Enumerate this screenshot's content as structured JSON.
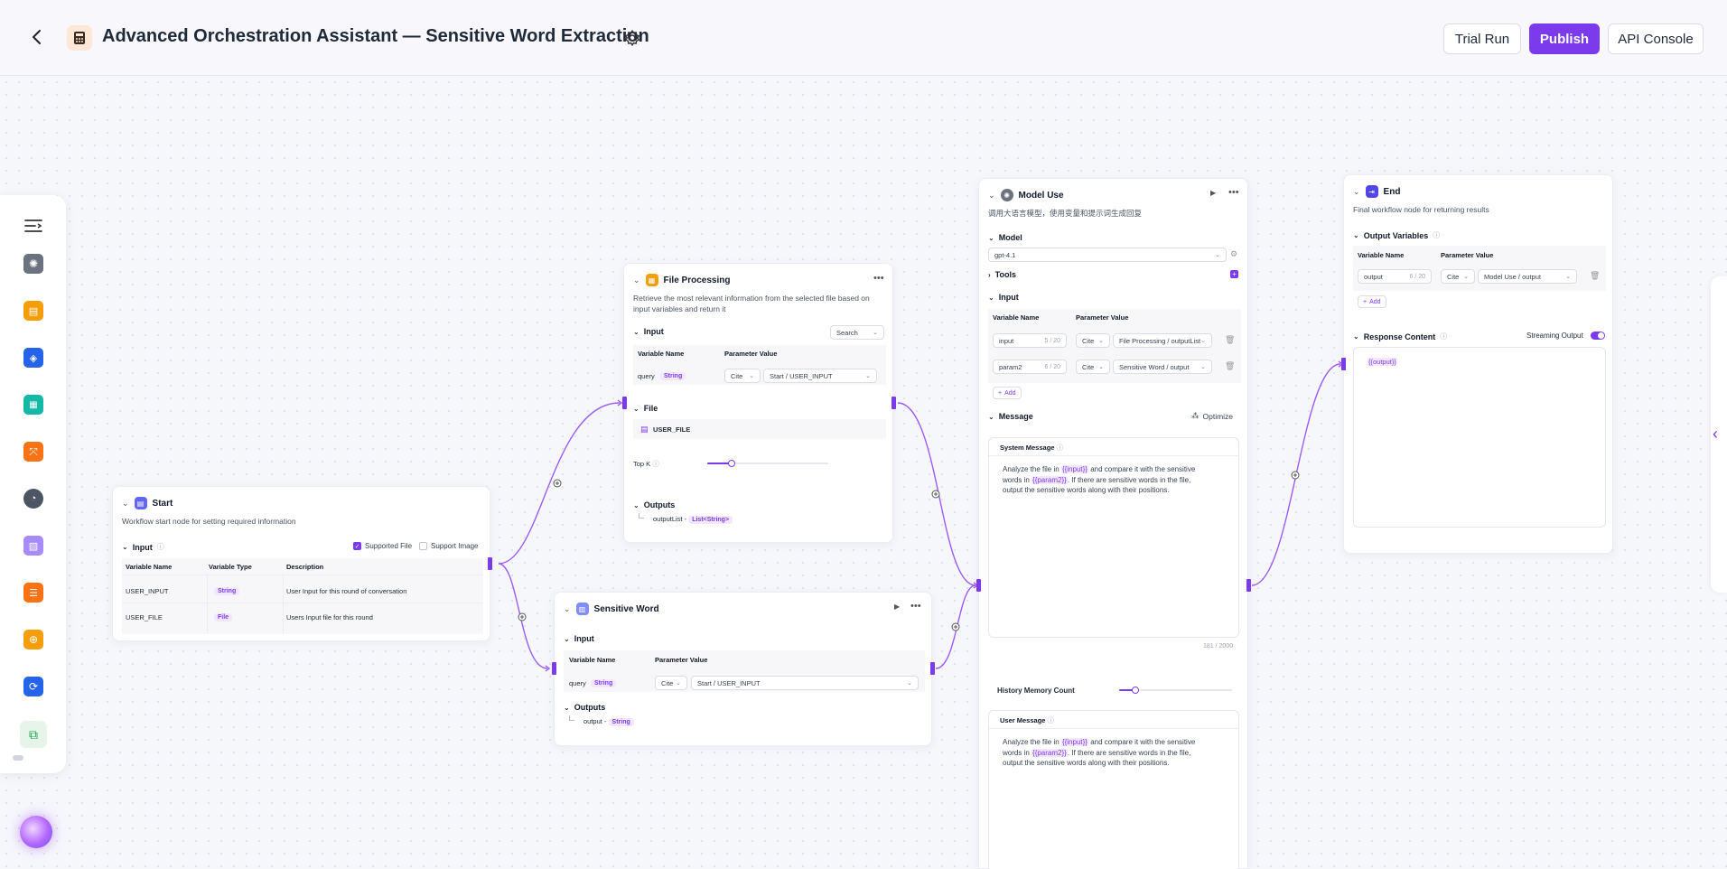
{
  "header": {
    "title": "Advanced Orchestration Assistant — Sensitive Word Extraction",
    "trial_run": "Trial Run",
    "publish": "Publish",
    "api_console": "API Console"
  },
  "sidebar": {
    "items": [
      "openai-icon",
      "note-icon",
      "cube-icon",
      "calendar-icon",
      "expand-icon",
      "chart-icon",
      "document-icon",
      "database-icon",
      "add-image-icon",
      "loop-icon",
      "workflow-icon"
    ]
  },
  "nodes": {
    "start": {
      "title": "Start",
      "desc": "Workflow start node for setting required information",
      "input_label": "Input",
      "supported_file": "Supported File",
      "support_image": "Support Image",
      "headers": [
        "Variable Name",
        "Variable Type",
        "Description"
      ],
      "rows": [
        {
          "name": "USER_INPUT",
          "type": "String",
          "desc": "User Input for this round of conversation"
        },
        {
          "name": "USER_FILE",
          "type": "File",
          "desc": "Users Input file for this round"
        }
      ]
    },
    "file_processing": {
      "title": "File Processing",
      "desc_line1": "Retrieve the most relevant information from the selected file based on",
      "desc_line2": "input variables and return it",
      "input_label": "Input",
      "search_select": "Search",
      "headers": [
        "Variable Name",
        "Parameter Value"
      ],
      "query_name": "query",
      "query_type": "String",
      "cite": "Cite",
      "query_value": "Start / USER_INPUT",
      "file_label": "File",
      "file_name": "USER_FILE",
      "topk_label": "Top K",
      "topk_value": 0.2,
      "outputs_label": "Outputs",
      "output_name": "outputList -",
      "output_type": "List<String>"
    },
    "sensitive_word": {
      "title": "Sensitive Word",
      "input_label": "Input",
      "headers": [
        "Variable Name",
        "Parameter Value"
      ],
      "query_name": "query",
      "query_type": "String",
      "cite": "Cite",
      "query_value": "Start / USER_INPUT",
      "outputs_label": "Outputs",
      "output_name": "output -",
      "output_type": "String"
    },
    "model_use": {
      "title": "Model Use",
      "desc": "调用大语言模型，使用变量和提示词生成回复",
      "model_label": "Model",
      "model_value": "gpt-4.1",
      "tools_label": "Tools",
      "input_label": "Input",
      "headers": [
        "Variable Name",
        "Parameter Value"
      ],
      "rows": [
        {
          "name": "input",
          "count": "5 / 20",
          "cite": "Cite",
          "value": "File Processing / outputList"
        },
        {
          "name": "param2",
          "count": "6 / 20",
          "cite": "Cite",
          "value": "Sensitive Word / output"
        }
      ],
      "add_label": "Add",
      "message_label": "Message",
      "optimize_label": "Optimize",
      "system_message_label": "System Message",
      "msg_line1_a": "Analyze the file in ",
      "msg_var_input": "{{input}}",
      "msg_line1_b": " and compare it with the sensitive",
      "msg_line2_a": "words in ",
      "msg_var_param2": "{{param2}}",
      "msg_line2_b": ". If there are sensitive words in the file,",
      "msg_line3": "output the sensitive words along with their positions.",
      "char_count": "181 / 2000",
      "history_label": "History Memory Count",
      "history_value": 0.15,
      "user_message_label": "User Message"
    },
    "end": {
      "title": "End",
      "desc": "Final workflow node for returning results",
      "output_vars_label": "Output Variables",
      "headers": [
        "Variable Name",
        "Parameter Value"
      ],
      "row": {
        "name": "output",
        "count": "6 / 20",
        "cite": "Cite",
        "value": "Model Use / output"
      },
      "add_label": "Add",
      "response_label": "Response Content",
      "streaming_label": "Streaming Output",
      "response_value": "{{output}}"
    }
  },
  "colors": {
    "accent": "#7c3aed",
    "tag_bg": "#f1e8ff"
  }
}
